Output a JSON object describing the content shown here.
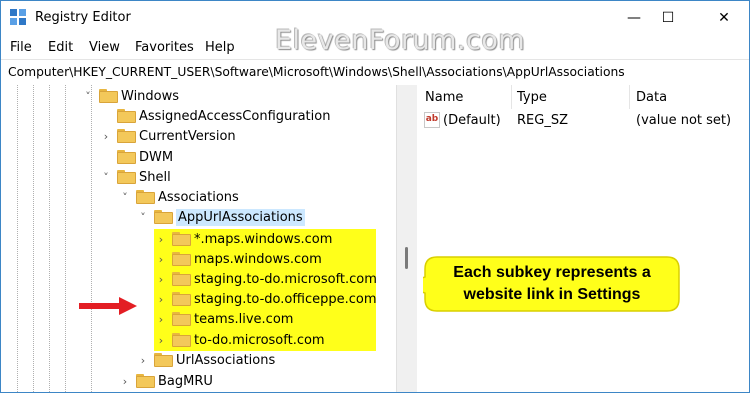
{
  "window": {
    "title": "Registry Editor",
    "controls": {
      "minimize": "—",
      "maximize": "☐",
      "close": "✕"
    }
  },
  "watermark": "ElevenForum.com",
  "menu": [
    "File",
    "Edit",
    "View",
    "Favorites",
    "Help"
  ],
  "address": "Computer\\HKEY_CURRENT_USER\\Software\\Microsoft\\Windows\\Shell\\Associations\\AppUrlAssociations",
  "tree": [
    {
      "label": "Windows",
      "chevron": "˅"
    },
    {
      "label": "AssignedAccessConfiguration",
      "chevron": ""
    },
    {
      "label": "CurrentVersion",
      "chevron": "›"
    },
    {
      "label": "DWM",
      "chevron": ""
    },
    {
      "label": "Shell",
      "chevron": "˅"
    },
    {
      "label": "Associations",
      "chevron": "˅"
    },
    {
      "label": "AppUrlAssociations",
      "chevron": "˅"
    },
    {
      "label": "*.maps.windows.com",
      "chevron": "›"
    },
    {
      "label": "maps.windows.com",
      "chevron": "›"
    },
    {
      "label": "staging.to-do.microsoft.com",
      "chevron": "›"
    },
    {
      "label": "staging.to-do.officeppe.com",
      "chevron": "›"
    },
    {
      "label": "teams.live.com",
      "chevron": "›"
    },
    {
      "label": "to-do.microsoft.com",
      "chevron": "›"
    },
    {
      "label": "UrlAssociations",
      "chevron": "›"
    },
    {
      "label": "BagMRU",
      "chevron": "›"
    }
  ],
  "list": {
    "columns": [
      "Name",
      "Type",
      "Data"
    ],
    "rows": [
      {
        "icon": "ab",
        "name": "(Default)",
        "type": "REG_SZ",
        "data": "(value not set)"
      }
    ]
  },
  "callout": {
    "line1": "Each subkey represents a",
    "line2": "website link in Settings"
  },
  "colors": {
    "highlight": "#ffff1a",
    "callout_fill": "#ffff1a",
    "arrow": "#e31e24",
    "selection": "#cce8ff"
  }
}
